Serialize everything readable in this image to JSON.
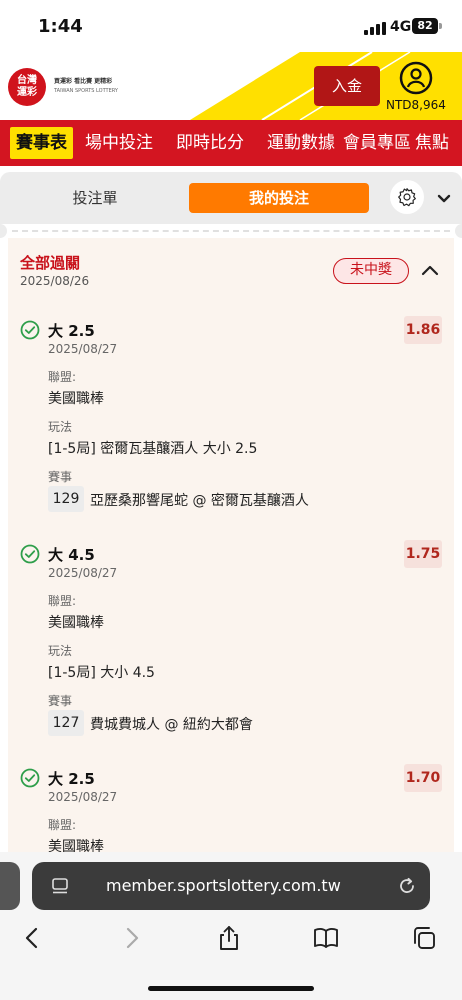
{
  "status": {
    "time": "1:44",
    "network": "4G",
    "battery": "82"
  },
  "header": {
    "logo_line1": "台灣",
    "logo_line2": "運彩",
    "logo_tagline": "買運彩 看比賽 更精彩",
    "logo_en": "TAIWAN SPORTS LOTTERY",
    "deposit_label": "入金",
    "balance": "NTD8,964",
    "brand_color": "#d31521",
    "accent_color": "#ffe000"
  },
  "nav": {
    "items": [
      "賽事表",
      "場中投注",
      "即時比分",
      "運動數據",
      "會員專區",
      "焦點"
    ]
  },
  "tabs": {
    "betslip": "投注單",
    "my_bets": "我的投注",
    "settings_icon": "gear-icon",
    "dropdown_icon": "chevron-down-icon"
  },
  "parlay": {
    "title": "全部過關",
    "date": "2025/08/26",
    "status": "未中獎"
  },
  "legs": [
    {
      "pick": "大 2.5",
      "date": "2025/08/27",
      "odds": "1.86",
      "league_label": "聯盟:",
      "league": "美國職棒",
      "bettype_label": "玩法",
      "bettype": "[1-5局] 密爾瓦基釀酒人 大小 2.5",
      "event_label": "賽事",
      "event_no": "129",
      "event_name": "亞歷桑那響尾蛇 @ 密爾瓦基釀酒人"
    },
    {
      "pick": "大 4.5",
      "date": "2025/08/27",
      "odds": "1.75",
      "league_label": "聯盟:",
      "league": "美國職棒",
      "bettype_label": "玩法",
      "bettype": "[1-5局] 大小 4.5",
      "event_label": "賽事",
      "event_no": "127",
      "event_name": "費城費城人 @ 紐約大都會"
    },
    {
      "pick": "大 2.5",
      "date": "2025/08/27",
      "odds": "1.70",
      "league_label": "聯盟:",
      "league": "美國職棒"
    }
  ],
  "browser": {
    "url": "member.sportslottery.com.tw"
  }
}
